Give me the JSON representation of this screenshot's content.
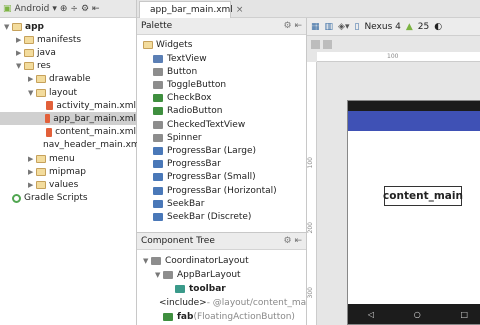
{
  "project": {
    "view_label": "Android",
    "tree": [
      {
        "label": "app",
        "type": "root",
        "indent": 0
      },
      {
        "label": "manifests",
        "type": "folder",
        "indent": 1
      },
      {
        "label": "java",
        "type": "folder",
        "indent": 1
      },
      {
        "label": "res",
        "type": "folder",
        "indent": 1
      },
      {
        "label": "drawable",
        "type": "folder",
        "indent": 2
      },
      {
        "label": "layout",
        "type": "folder",
        "indent": 2
      },
      {
        "label": "activity_main.xml",
        "type": "xml",
        "indent": 3
      },
      {
        "label": "app_bar_main.xml",
        "type": "xml",
        "indent": 3,
        "selected": true
      },
      {
        "label": "content_main.xml",
        "type": "xml",
        "indent": 3
      },
      {
        "label": "nav_header_main.xml",
        "type": "xml",
        "indent": 3
      },
      {
        "label": "menu",
        "type": "folder",
        "indent": 2
      },
      {
        "label": "mipmap",
        "type": "folder",
        "indent": 2
      },
      {
        "label": "values",
        "type": "folder",
        "indent": 2
      },
      {
        "label": "Gradle Scripts",
        "type": "gradle",
        "indent": 0
      }
    ]
  },
  "editor": {
    "tab_label": "app_bar_main.xml",
    "tab_close": "×"
  },
  "palette": {
    "title": "Palette",
    "group": "Widgets",
    "items": [
      {
        "label": "TextView",
        "color": "#5b7fb5"
      },
      {
        "label": "Button",
        "color": "#8d8d8d"
      },
      {
        "label": "ToggleButton",
        "color": "#8d8d8d"
      },
      {
        "label": "CheckBox",
        "color": "#3f8f3f"
      },
      {
        "label": "RadioButton",
        "color": "#3f8f3f"
      },
      {
        "label": "CheckedTextView",
        "color": "#8d8d8d"
      },
      {
        "label": "Spinner",
        "color": "#8d8d8d"
      },
      {
        "label": "ProgressBar (Large)",
        "color": "#4a78b8"
      },
      {
        "label": "ProgressBar",
        "color": "#4a78b8"
      },
      {
        "label": "ProgressBar (Small)",
        "color": "#4a78b8"
      },
      {
        "label": "ProgressBar (Horizontal)",
        "color": "#4a78b8"
      },
      {
        "label": "SeekBar",
        "color": "#4a78b8"
      },
      {
        "label": "SeekBar (Discrete)",
        "color": "#4a78b8"
      }
    ]
  },
  "component_tree": {
    "title": "Component Tree",
    "items": [
      {
        "label": "CoordinatorLayout",
        "indent": 0
      },
      {
        "label": "AppBarLayout",
        "indent": 1
      },
      {
        "label": "toolbar",
        "indent": 2,
        "bold": true
      },
      {
        "label": "<include>",
        "suffix": " - @layout/content_main",
        "indent": 1
      },
      {
        "label": "fab",
        "suffix": " (FloatingActionButton)",
        "indent": 1,
        "bold": true
      }
    ]
  },
  "design_toolbar": {
    "device": "Nexus 4",
    "api": "25",
    "ruler_mark": "100",
    "left_ruler_marks": [
      "100",
      "200",
      "300"
    ]
  },
  "canvas": {
    "content_label": "content_main",
    "app_bar_color": "#3f51b5"
  }
}
